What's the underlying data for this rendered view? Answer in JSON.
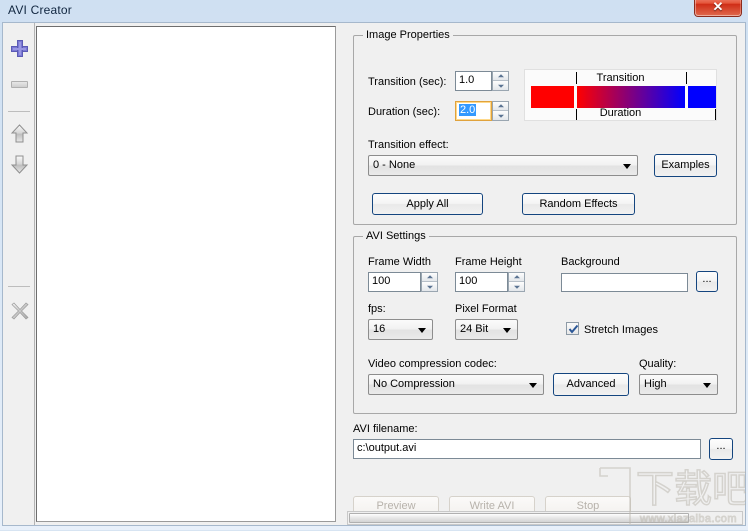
{
  "window": {
    "title": "AVI Creator",
    "close_label": "✕"
  },
  "toolbar": {
    "items": [
      {
        "name": "add-images-button",
        "icon": "plus-icon",
        "enabled": true
      },
      {
        "name": "remove-image-button",
        "icon": "minus-icon",
        "enabled": false
      },
      {
        "name": "move-up-button",
        "icon": "arrow-up-icon",
        "enabled": true
      },
      {
        "name": "move-down-button",
        "icon": "arrow-down-icon",
        "enabled": true
      },
      {
        "name": "clear-all-button",
        "icon": "x-icon",
        "enabled": false
      }
    ]
  },
  "file_list": {
    "items": []
  },
  "image_properties": {
    "legend": "Image Properties",
    "transition_label": "Transition (sec):",
    "transition_value": "1.0",
    "duration_label": "Duration (sec):",
    "duration_value": "2.0",
    "transition_effect_label": "Transition effect:",
    "transition_effect_value": "0 - None",
    "examples_label": "Examples",
    "apply_all_label": "Apply All",
    "random_effects_label": "Random Effects",
    "preview": {
      "top_label": "Transition",
      "bottom_label": "Duration",
      "start_color": "#ff0000",
      "end_color": "#0000ff"
    }
  },
  "avi_settings": {
    "legend": "AVI Settings",
    "frame_width_label": "Frame Width",
    "frame_width_value": "100",
    "frame_height_label": "Frame Height",
    "frame_height_value": "100",
    "background_label": "Background",
    "background_value": "",
    "background_browse_label": "...",
    "fps_label": "fps:",
    "fps_value": "16",
    "pixel_format_label": "Pixel Format",
    "pixel_format_value": "24 Bit",
    "stretch_images_label": "Stretch Images",
    "stretch_images_checked": true,
    "codec_label": "Video compression codec:",
    "codec_value": "No Compression",
    "advanced_label": "Advanced",
    "quality_label": "Quality:",
    "quality_value": "High"
  },
  "output": {
    "filename_label": "AVI filename:",
    "filename_value": "c:\\output.avi",
    "filename_browse_label": "...",
    "preview_label": "Preview",
    "write_avi_label": "Write AVI",
    "stop_label": "Stop",
    "preview_enabled": false,
    "write_avi_enabled": false,
    "stop_enabled": false
  },
  "watermark": {
    "logo_text": "下载吧",
    "url_text": "www.xiazaiba.com"
  },
  "colors": {
    "accent": "#14457f",
    "titlebar": "#cfe0f2",
    "close_button": "#cf2d16",
    "selection": "#3399ff",
    "focus_border": "#e0a23c"
  }
}
